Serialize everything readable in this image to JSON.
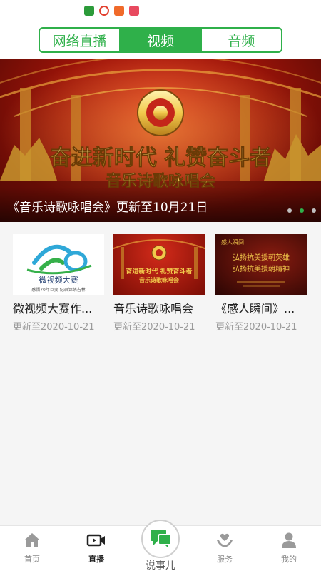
{
  "tabs": [
    {
      "label": "网络直播",
      "active": false
    },
    {
      "label": "视频",
      "active": true
    },
    {
      "label": "音频",
      "active": false
    }
  ],
  "banner": {
    "headline": "奋进新时代 礼赞奋斗者",
    "subheadline": "音乐诗歌咏唱会",
    "caption": "《音乐诗歌咏唱会》更新至10月21日",
    "active_dot": 2,
    "dot_count": 3
  },
  "videos": [
    {
      "title": "微视频大赛作...",
      "date": "更新至2020-10-21",
      "thumb_logo_text": "微视频大赛",
      "thumb_sub_text": "感悟70年巨变 纪录锦绣吉林"
    },
    {
      "title": "音乐诗歌咏唱会",
      "date": "更新至2020-10-21",
      "thumb_line1": "奋进新时代 礼赞奋斗者",
      "thumb_line2": "音乐诗歌咏唱会"
    },
    {
      "title": "《感人瞬间》...",
      "date": "更新至2020-10-21",
      "thumb_tag": "感人瞬间",
      "thumb_line1": "弘扬抗美援朝英雄",
      "thumb_line2": "弘扬抗美援朝精神"
    }
  ],
  "bottom_nav": {
    "items": [
      {
        "label": "首页",
        "icon": "home-icon",
        "active": false
      },
      {
        "label": "直播",
        "icon": "video-camera-icon",
        "active": true
      },
      {
        "label": "服务",
        "icon": "heart-hands-icon",
        "active": false
      },
      {
        "label": "我的",
        "icon": "person-icon",
        "active": false
      }
    ],
    "center": {
      "label": "说事儿",
      "icon": "chat-bubbles-icon"
    }
  },
  "colors": {
    "accent": "#2fb04a",
    "banner_red": "#b51a0d",
    "gold": "#f2c94c"
  }
}
